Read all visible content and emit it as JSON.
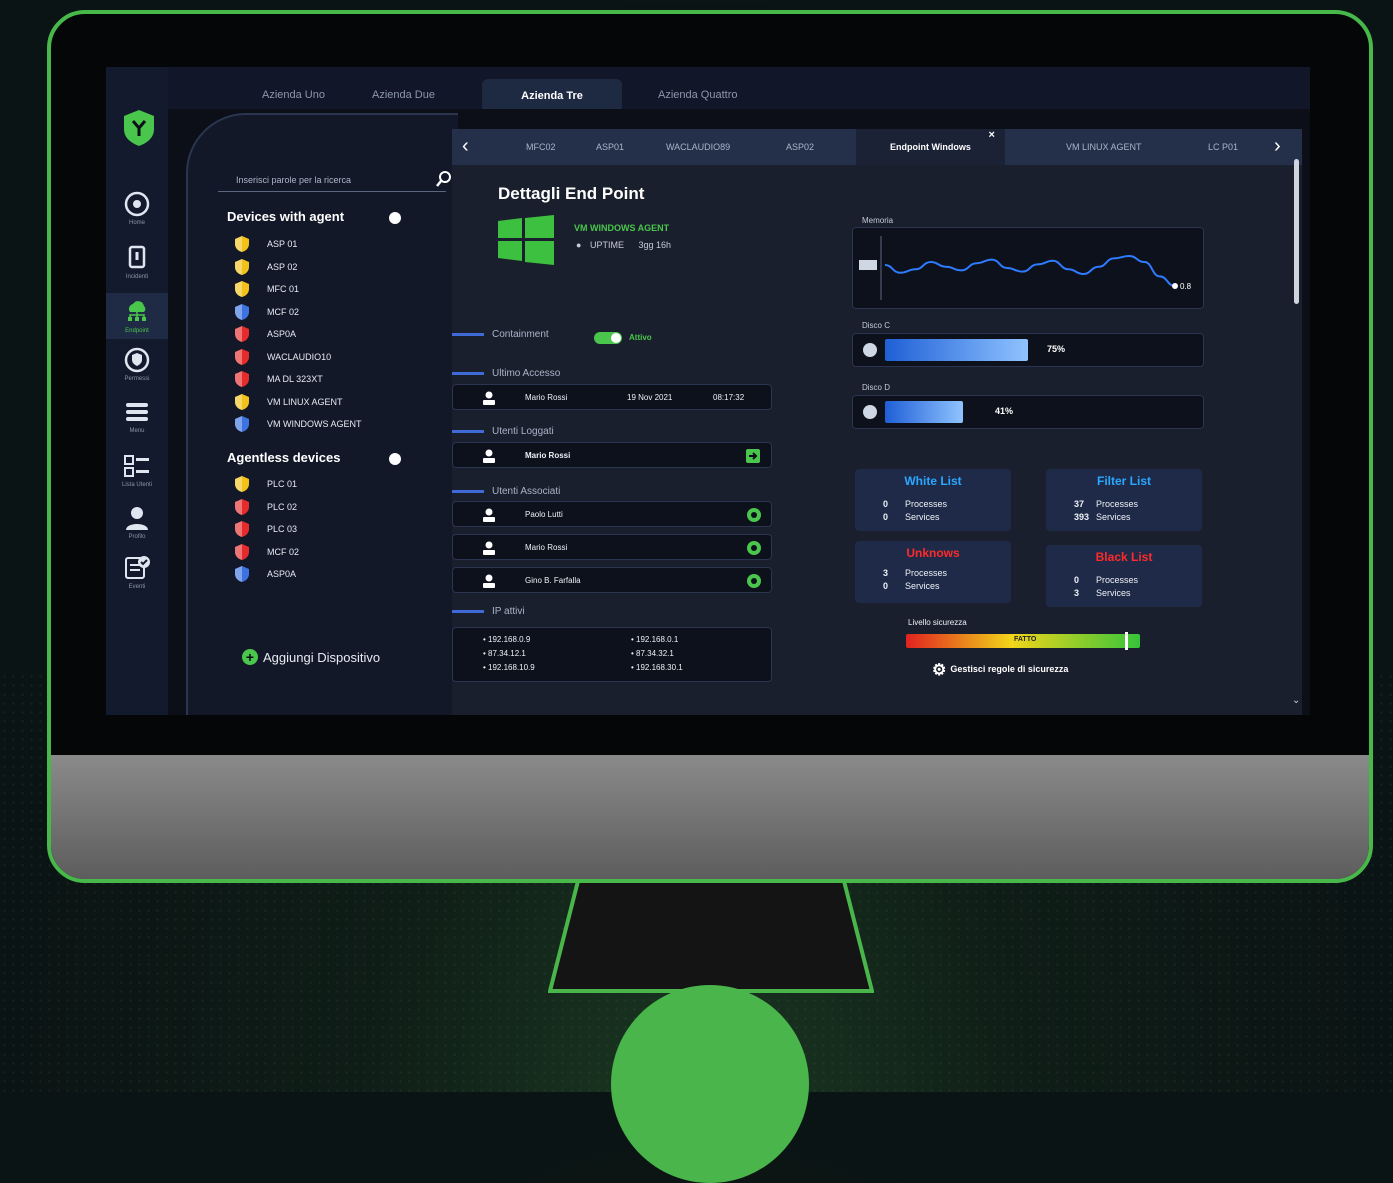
{
  "company_tabs": [
    "Azienda Uno",
    "Azienda Due",
    "Azienda Tre",
    "Azienda Quattro"
  ],
  "company_active": "Azienda Tre",
  "nav": [
    "Home",
    "Incidenti",
    "Endpoint",
    "Permessi",
    "Menu",
    "Lista Utenti",
    "Profilo",
    "Eventi"
  ],
  "nav_active": "Endpoint",
  "search_placeholder": "Inserisci parole per la ricerca",
  "devices_with_agent": {
    "title": "Devices with agent",
    "items": [
      {
        "name": "ASP 01",
        "status": "yellow"
      },
      {
        "name": "ASP 02",
        "status": "yellow"
      },
      {
        "name": "MFC 01",
        "status": "yellow"
      },
      {
        "name": "MCF 02",
        "status": "blue"
      },
      {
        "name": "ASP0A",
        "status": "red"
      },
      {
        "name": "WACLAUDIO10",
        "status": "red"
      },
      {
        "name": "MA DL 323XT",
        "status": "red"
      },
      {
        "name": "VM LINUX AGENT",
        "status": "yellow"
      },
      {
        "name": "VM WINDOWS AGENT",
        "status": "blue"
      }
    ]
  },
  "agentless_devices": {
    "title": "Agentless devices",
    "items": [
      {
        "name": "PLC 01",
        "status": "yellow"
      },
      {
        "name": "PLC 02",
        "status": "red"
      },
      {
        "name": "PLC 03",
        "status": "red"
      },
      {
        "name": "MCF 02",
        "status": "red"
      },
      {
        "name": "ASP0A",
        "status": "blue"
      }
    ]
  },
  "add_device": "Aggiungi Dispositivo",
  "endpoint_tabs": [
    "MFC02",
    "ASP01",
    "WACLAUDIO89",
    "ASP02",
    "Endpoint Windows",
    "VM LINUX AGENT",
    "LC P01"
  ],
  "endpoint_tab_active": "Endpoint Windows",
  "details": {
    "title": "Dettagli End Point",
    "agent_name": "VM WINDOWS AGENT",
    "uptime_label": "UPTIME",
    "uptime_value": "3gg 16h"
  },
  "containment": {
    "label": "Containment",
    "state": "Attivo"
  },
  "last_access": {
    "label": "Ultimo Accesso",
    "user": "Mario Rossi",
    "date": "19 Nov 2021",
    "time": "08:17:32"
  },
  "logged_users": {
    "label": "Utenti Loggati",
    "users": [
      "Mario Rossi"
    ]
  },
  "associated_users": {
    "label": "Utenti Associati",
    "users": [
      "Paolo Lutti",
      "Mario Rossi",
      "Gino B. Farfalla"
    ]
  },
  "active_ips": {
    "label": "IP attivi",
    "ips": [
      "192.168.0.9",
      "87.34.12.1",
      "192.168.10.9",
      "192.168.0.1",
      "87.34.32.1",
      "192.168.30.1"
    ]
  },
  "memory": {
    "label": "Memoria",
    "current": "0.8",
    "series": [
      55,
      42,
      48,
      60,
      52,
      46,
      58,
      64,
      50,
      44,
      56,
      62,
      48,
      40,
      52,
      66,
      70,
      60,
      36,
      20
    ]
  },
  "disk_c": {
    "label": "Disco C",
    "percent": 75,
    "display": "75%"
  },
  "disk_d": {
    "label": "Disco D",
    "percent": 41,
    "display": "41%"
  },
  "lists": [
    {
      "title": "White List",
      "color": "#2aa8ff",
      "processes": "0",
      "services": "0"
    },
    {
      "title": "Filter List",
      "color": "#2aa8ff",
      "processes": "37",
      "services": "393"
    },
    {
      "title": "Unknows",
      "color": "#ff2a2a",
      "processes": "3",
      "services": "0"
    },
    {
      "title": "Black List",
      "color": "#ff2a2a",
      "processes": "0",
      "services": "3"
    }
  ],
  "processes_label": "Processes",
  "services_label": "Services",
  "security_level": {
    "label": "Livello sicurezza",
    "value": 0.95,
    "marker_text": "FATTO"
  },
  "manage_rules": "Gestisci regole di sicurezza",
  "colors": {
    "accent": "#49c64b",
    "blue": "#2f6fe0",
    "red": "#ff2a2a"
  }
}
